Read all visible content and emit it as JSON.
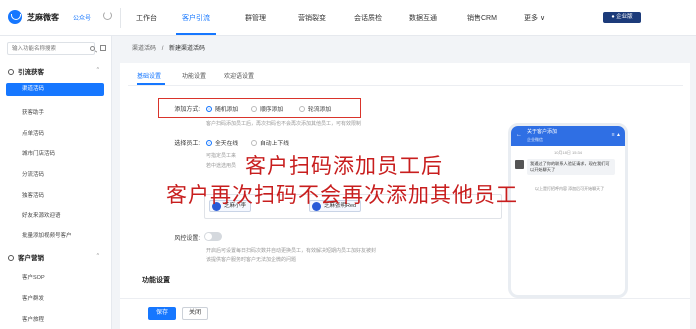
{
  "header": {
    "brand": "芝麻微客",
    "account_type": "公众号",
    "nav": [
      "工作台",
      "客户引流",
      "群管理",
      "营销裂变",
      "会话质检",
      "数据互通",
      "销售CRM",
      "更多 ∨"
    ],
    "version_badge": "● 企业版"
  },
  "sidebar": {
    "search_placeholder": "输入功能名称搜索",
    "group1": "引流获客",
    "group1_items": [
      "渠道活码",
      "获客助手",
      "点单活码",
      "城市门店活码",
      "分流活码",
      "独客活码",
      "好友来源欢迎语",
      "批量添加视频号客户"
    ],
    "group2": "客户营销",
    "group2_items": [
      "客户SOP",
      "客户群发",
      "客户旅程"
    ],
    "caret": "^"
  },
  "breadcrumb": {
    "parent": "渠道活码",
    "separator": "/",
    "current": "新建渠道活码"
  },
  "tabs": [
    "基础设置",
    "功能设置",
    "欢迎语设置"
  ],
  "form": {
    "add_mode_label": "添加方式:",
    "add_mode_options": [
      "随机添加",
      "顺序添加",
      "轮流添加"
    ],
    "add_mode_hint": "客户扫码添加员工后，再次扫码也不会再次添加其他员工，可有效限制",
    "staff_label": "选择员工:",
    "staff_options": [
      "全天在线",
      "自动上下线"
    ],
    "staff_hint1": "可指定员工来",
    "staff_hint2": "若中途选用员",
    "staff_tags": [
      "芝麻小李",
      "芝麻张明Red"
    ],
    "risk_label": "风控设置:",
    "risk_hint1": "开启后可设置每日扫码次数并自动更换员工，有效解决短期内员工加好友被封",
    "risk_hint2": "该提供客户服务时客户无法加企微的问题",
    "section_title": "功能设置"
  },
  "phone": {
    "title": "关于客户添加",
    "subtitle": "企业微信",
    "time": "10月18日 15:34",
    "bubble": "我通过了你的联系人验证请求，现在我们可以开始聊天了",
    "line": "以上是打招呼内容 添加后可开始聊天了"
  },
  "captions": {
    "line1": "客户扫码添加员工后",
    "line2": "客户再次扫码不会再次添加其他员工"
  },
  "buttons": {
    "save": "保存",
    "close": "关闭"
  },
  "colors": {
    "accent": "#1677ff",
    "highlight": "#d9342b",
    "caption": "#c81e1e"
  }
}
